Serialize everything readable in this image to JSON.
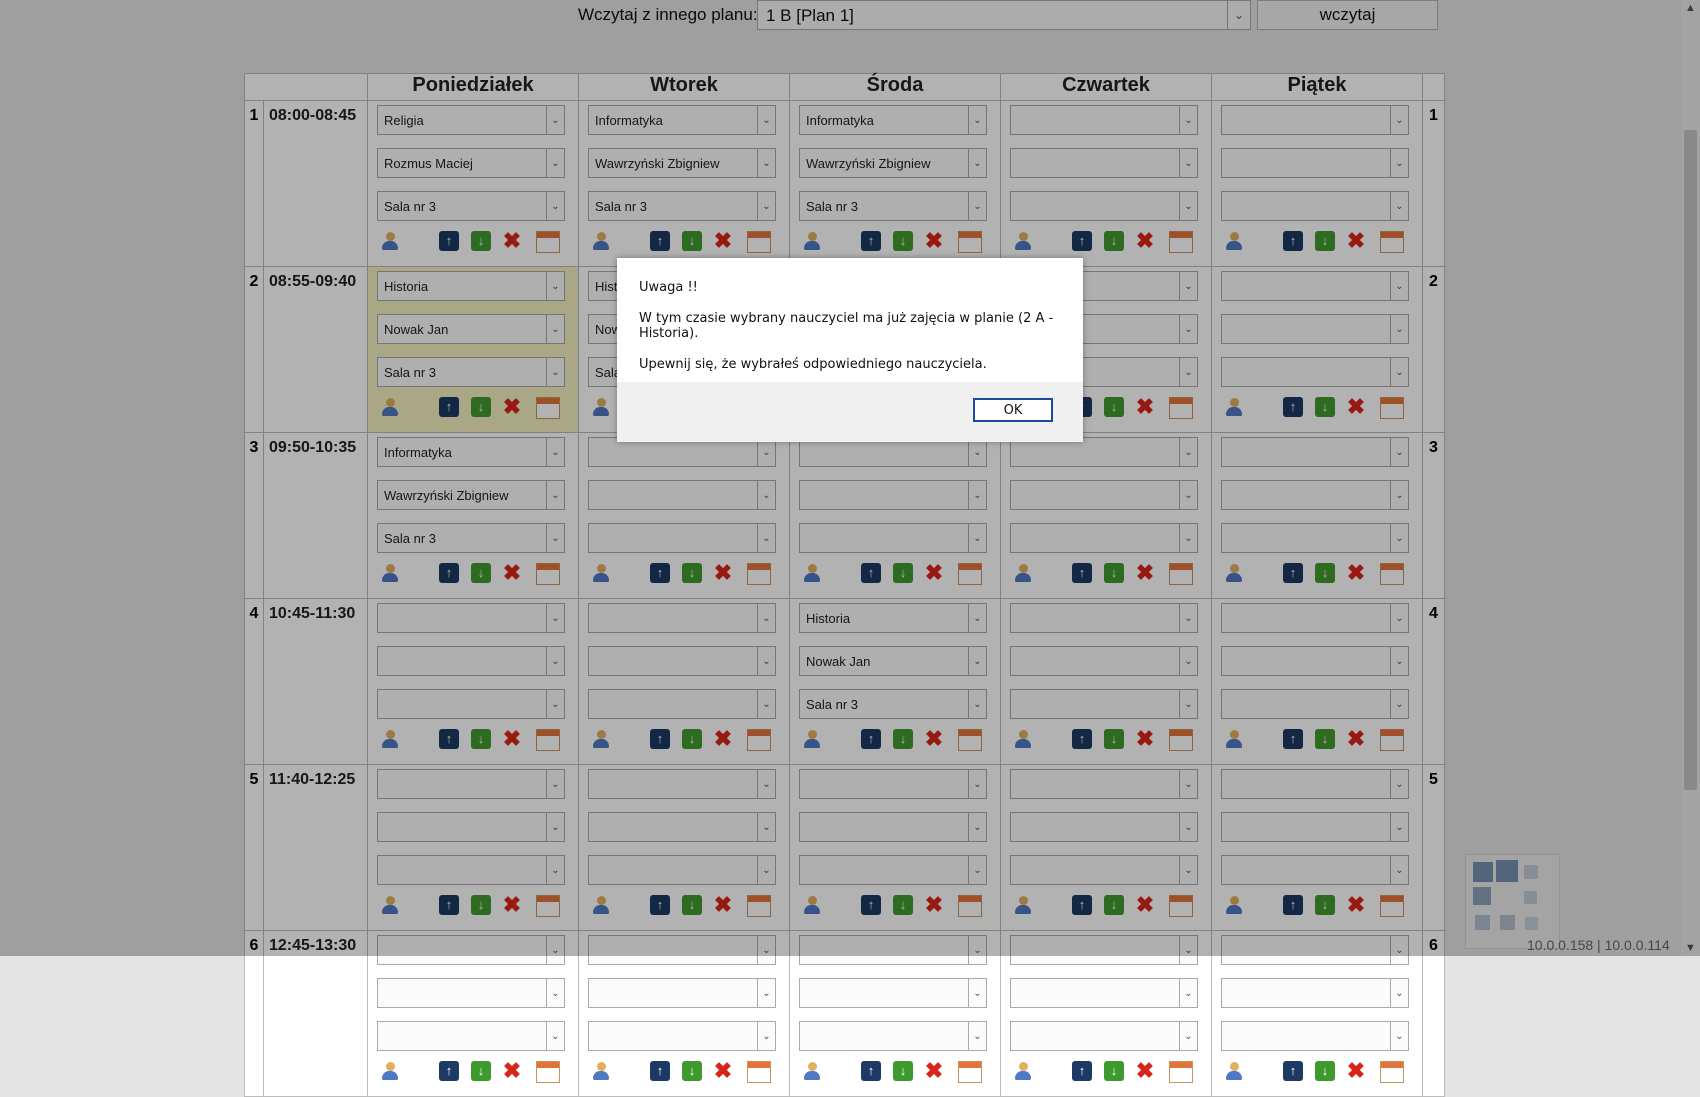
{
  "top": {
    "load_label": "Wczytaj z innego planu:",
    "plan_value": "1 B [Plan 1]",
    "load_button": "wczytaj"
  },
  "days": [
    "Poniedziałek",
    "Wtorek",
    "Środa",
    "Czwartek",
    "Piątek"
  ],
  "periods": [
    {
      "num": "1",
      "time": "08:00-08:45",
      "cells": [
        {
          "subject": "Religia",
          "teacher": "Rozmus Maciej",
          "room": "Sala nr 3"
        },
        {
          "subject": "Informatyka",
          "teacher": "Wawrzyński Zbigniew",
          "room": "Sala nr 3"
        },
        {
          "subject": "Informatyka",
          "teacher": "Wawrzyński Zbigniew",
          "room": "Sala nr 3"
        },
        {
          "subject": "",
          "teacher": "",
          "room": ""
        },
        {
          "subject": "",
          "teacher": "",
          "room": ""
        }
      ]
    },
    {
      "num": "2",
      "time": "08:55-09:40",
      "cells": [
        {
          "subject": "Historia",
          "teacher": "Nowak Jan",
          "room": "Sala nr 3",
          "highlight": true
        },
        {
          "subject": "Histo",
          "teacher": "Now",
          "room": "Sala"
        },
        {
          "subject": "",
          "teacher": "",
          "room": ""
        },
        {
          "subject": "",
          "teacher": "",
          "room": ""
        },
        {
          "subject": "",
          "teacher": "",
          "room": ""
        }
      ]
    },
    {
      "num": "3",
      "time": "09:50-10:35",
      "cells": [
        {
          "subject": "Informatyka",
          "teacher": "Wawrzyński Zbigniew",
          "room": "Sala nr 3"
        },
        {
          "subject": "",
          "teacher": "",
          "room": ""
        },
        {
          "subject": "",
          "teacher": "",
          "room": ""
        },
        {
          "subject": "",
          "teacher": "",
          "room": ""
        },
        {
          "subject": "",
          "teacher": "",
          "room": ""
        }
      ]
    },
    {
      "num": "4",
      "time": "10:45-11:30",
      "cells": [
        {
          "subject": "",
          "teacher": "",
          "room": ""
        },
        {
          "subject": "",
          "teacher": "",
          "room": ""
        },
        {
          "subject": "Historia",
          "teacher": "Nowak Jan",
          "room": "Sala nr 3"
        },
        {
          "subject": "",
          "teacher": "",
          "room": ""
        },
        {
          "subject": "",
          "teacher": "",
          "room": ""
        }
      ]
    },
    {
      "num": "5",
      "time": "11:40-12:25",
      "cells": [
        {
          "subject": "",
          "teacher": "",
          "room": ""
        },
        {
          "subject": "",
          "teacher": "",
          "room": ""
        },
        {
          "subject": "",
          "teacher": "",
          "room": ""
        },
        {
          "subject": "",
          "teacher": "",
          "room": ""
        },
        {
          "subject": "",
          "teacher": "",
          "room": ""
        }
      ]
    },
    {
      "num": "6",
      "time": "12:45-13:30",
      "cells": [
        {
          "subject": "",
          "teacher": "",
          "room": ""
        },
        {
          "subject": "",
          "teacher": "",
          "room": ""
        },
        {
          "subject": "",
          "teacher": "",
          "room": ""
        },
        {
          "subject": "",
          "teacher": "",
          "room": ""
        },
        {
          "subject": "",
          "teacher": "",
          "room": ""
        }
      ]
    }
  ],
  "icons": {
    "assign": "teacher-icon",
    "up": "arrow-up-icon",
    "down": "arrow-down-icon",
    "delete": "delete-icon",
    "calendar": "calendar-icon"
  },
  "dialog": {
    "title": "Uwaga !!",
    "message": "W tym czasie wybrany nauczyciel ma już zajęcia w planie (2 A - Historia).",
    "hint": "Upewnij się, że wybrałeś odpowiedniego nauczyciela.",
    "ok": "OK"
  },
  "footer": {
    "ip": "10.0.0.158 | 10.0.0.114"
  },
  "colors": {
    "highlight": "#f4f0c2",
    "up": "#1c3a63",
    "down": "#3f9a2e",
    "delete": "#d9241b"
  }
}
